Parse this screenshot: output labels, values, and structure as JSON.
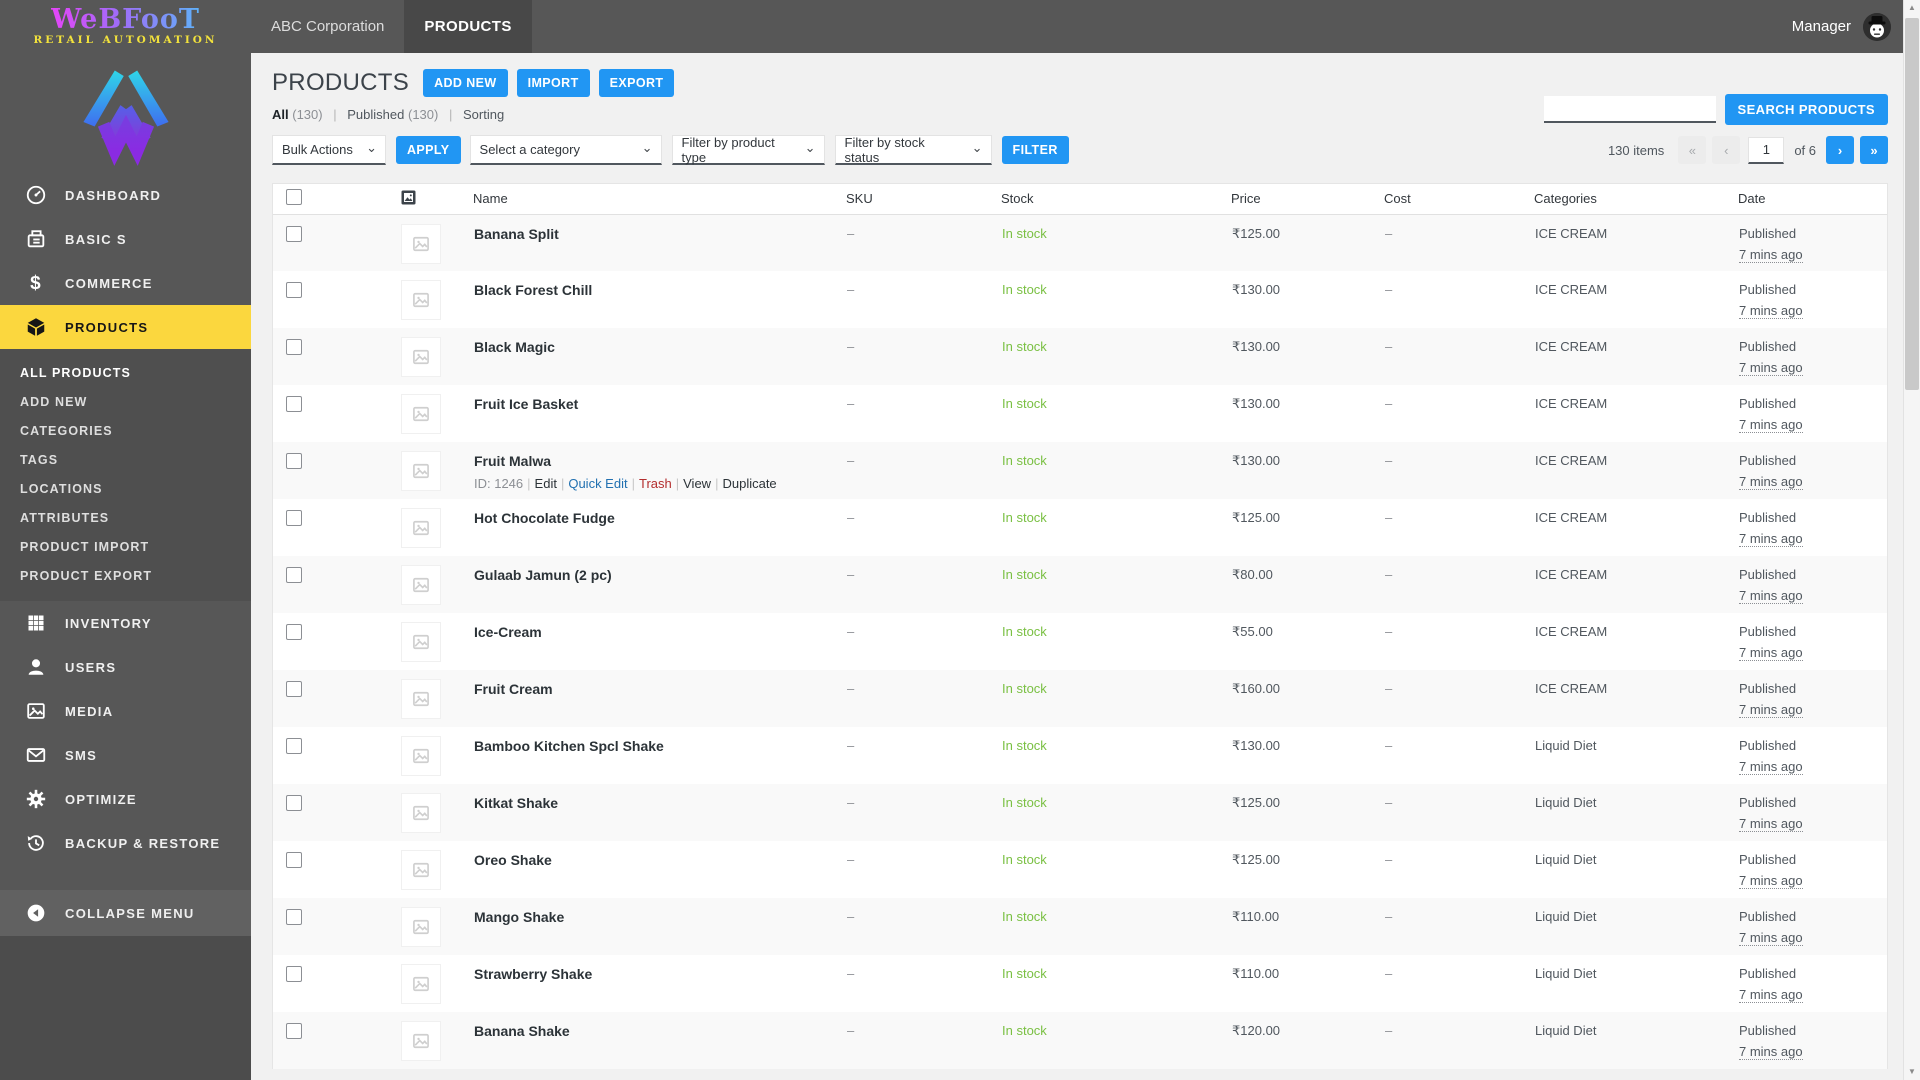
{
  "brand": {
    "name": "WeBFooT",
    "tagline": "RETAIL AUTOMATION"
  },
  "topbar": {
    "tabs": [
      {
        "label": "ABC Corporation",
        "active": false
      },
      {
        "label": "PRODUCTS",
        "active": true
      }
    ],
    "user_label": "Manager"
  },
  "sidebar": {
    "items_top": [
      {
        "label": "DASHBOARD"
      },
      {
        "label": "BASIC S"
      },
      {
        "label": "COMMERCE"
      },
      {
        "label": "PRODUCTS"
      }
    ],
    "submenu": [
      "ALL PRODUCTS",
      "ADD NEW",
      "CATEGORIES",
      "TAGS",
      "LOCATIONS",
      "ATTRIBUTES",
      "PRODUCT IMPORT",
      "PRODUCT EXPORT"
    ],
    "items_bottom": [
      {
        "label": "INVENTORY"
      },
      {
        "label": "USERS"
      },
      {
        "label": "MEDIA"
      },
      {
        "label": "SMS"
      },
      {
        "label": "OPTIMIZE"
      },
      {
        "label": "BACKUP & RESTORE"
      }
    ],
    "collapse_label": "COLLAPSE MENU"
  },
  "page": {
    "title": "PRODUCTS",
    "actions": {
      "add_new": "ADD NEW",
      "import": "IMPORT",
      "export": "EXPORT"
    },
    "views": [
      {
        "label": "All",
        "count": "(130)",
        "current": true
      },
      {
        "label": "Published",
        "count": "(130)",
        "current": false
      },
      {
        "label": "Sorting",
        "count": "",
        "current": false
      }
    ],
    "filters": {
      "bulk_actions": "Bulk Actions",
      "apply": "APPLY",
      "category": "Select a category",
      "product_type": "Filter by product type",
      "stock_status": "Filter by stock status",
      "filter": "FILTER"
    },
    "search": {
      "value": "",
      "button": "SEARCH PRODUCTS"
    },
    "pagination": {
      "total": "130 items",
      "first": "«",
      "prev": "‹",
      "current_page": "1",
      "of": "of 6",
      "next": "›",
      "last": "»"
    }
  },
  "table": {
    "headers": {
      "name": "Name",
      "sku": "SKU",
      "stock": "Stock",
      "price": "Price",
      "cost": "Cost",
      "categories": "Categories",
      "date": "Date"
    },
    "rows": [
      {
        "name": "Banana Split",
        "sku": "–",
        "stock": "In stock",
        "price": "₹125.00",
        "cost": "–",
        "categories": "ICE CREAM",
        "status": "Published",
        "ago": "7 mins ago"
      },
      {
        "name": "Black Forest Chill",
        "sku": "–",
        "stock": "In stock",
        "price": "₹130.00",
        "cost": "–",
        "categories": "ICE CREAM",
        "status": "Published",
        "ago": "7 mins ago"
      },
      {
        "name": "Black Magic",
        "sku": "–",
        "stock": "In stock",
        "price": "₹130.00",
        "cost": "–",
        "categories": "ICE CREAM",
        "status": "Published",
        "ago": "7 mins ago"
      },
      {
        "name": "Fruit Ice Basket",
        "sku": "–",
        "stock": "In stock",
        "price": "₹130.00",
        "cost": "–",
        "categories": "ICE CREAM",
        "status": "Published",
        "ago": "7 mins ago"
      },
      {
        "name": "Fruit Malwa",
        "sku": "–",
        "stock": "In stock",
        "price": "₹130.00",
        "cost": "–",
        "categories": "ICE CREAM",
        "status": "Published",
        "ago": "7 mins ago",
        "actions": {
          "id_label": "ID: 1246",
          "links": [
            {
              "label": "Edit",
              "color": "dark"
            },
            {
              "label": "Quick Edit",
              "color": "blue"
            },
            {
              "label": "Trash",
              "color": "red"
            },
            {
              "label": "View",
              "color": "dark"
            },
            {
              "label": "Duplicate",
              "color": "dark"
            }
          ]
        }
      },
      {
        "name": "Hot Chocolate Fudge",
        "sku": "–",
        "stock": "In stock",
        "price": "₹125.00",
        "cost": "–",
        "categories": "ICE CREAM",
        "status": "Published",
        "ago": "7 mins ago"
      },
      {
        "name": "Gulaab Jamun (2 pc)",
        "sku": "–",
        "stock": "In stock",
        "price": "₹80.00",
        "cost": "–",
        "categories": "ICE CREAM",
        "status": "Published",
        "ago": "7 mins ago"
      },
      {
        "name": "Ice-Cream",
        "sku": "–",
        "stock": "In stock",
        "price": "₹55.00",
        "cost": "–",
        "categories": "ICE CREAM",
        "status": "Published",
        "ago": "7 mins ago"
      },
      {
        "name": "Fruit Cream",
        "sku": "–",
        "stock": "In stock",
        "price": "₹160.00",
        "cost": "–",
        "categories": "ICE CREAM",
        "status": "Published",
        "ago": "7 mins ago"
      },
      {
        "name": "Bamboo Kitchen Spcl Shake",
        "sku": "–",
        "stock": "In stock",
        "price": "₹130.00",
        "cost": "–",
        "categories": "Liquid Diet",
        "status": "Published",
        "ago": "7 mins ago"
      },
      {
        "name": "Kitkat Shake",
        "sku": "–",
        "stock": "In stock",
        "price": "₹125.00",
        "cost": "–",
        "categories": "Liquid Diet",
        "status": "Published",
        "ago": "7 mins ago"
      },
      {
        "name": "Oreo Shake",
        "sku": "–",
        "stock": "In stock",
        "price": "₹125.00",
        "cost": "–",
        "categories": "Liquid Diet",
        "status": "Published",
        "ago": "7 mins ago"
      },
      {
        "name": "Mango Shake",
        "sku": "–",
        "stock": "In stock",
        "price": "₹110.00",
        "cost": "–",
        "categories": "Liquid Diet",
        "status": "Published",
        "ago": "7 mins ago"
      },
      {
        "name": "Strawberry Shake",
        "sku": "–",
        "stock": "In stock",
        "price": "₹110.00",
        "cost": "–",
        "categories": "Liquid Diet",
        "status": "Published",
        "ago": "7 mins ago"
      },
      {
        "name": "Banana Shake",
        "sku": "–",
        "stock": "In stock",
        "price": "₹120.00",
        "cost": "–",
        "categories": "Liquid Diet",
        "status": "Published",
        "ago": "7 mins ago"
      }
    ]
  },
  "colors": {
    "topbar_gray": "#575757",
    "active_tab_gray": "#484848",
    "sidebar_active_yellow": "#fbd73e",
    "accent_blue": "#2196f3",
    "stock_green": "#7ac043",
    "brand_gradient_start": "#e545f8",
    "brand_gradient_end": "#5fb2f9",
    "tagline_yellow": "#f2e23c"
  }
}
